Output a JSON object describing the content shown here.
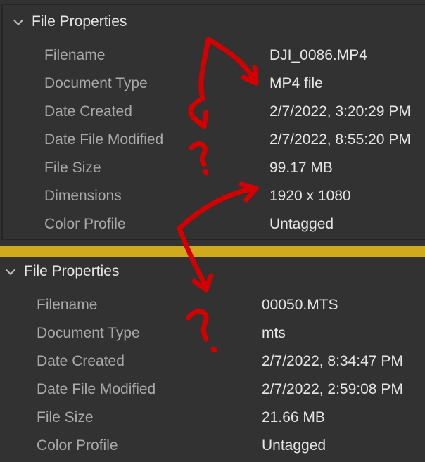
{
  "panels": [
    {
      "title": "File Properties",
      "rows": [
        {
          "label": "Filename",
          "value": "DJI_0086.MP4"
        },
        {
          "label": "Document Type",
          "value": "MP4 file"
        },
        {
          "label": "Date Created",
          "value": "2/7/2022, 3:20:29 PM"
        },
        {
          "label": "Date File Modified",
          "value": "2/7/2022, 8:55:20 PM"
        },
        {
          "label": "File Size",
          "value": "99.17 MB"
        },
        {
          "label": "Dimensions",
          "value": "1920 x 1080"
        },
        {
          "label": "Color Profile",
          "value": "Untagged"
        }
      ]
    },
    {
      "title": "File Properties",
      "rows": [
        {
          "label": "Filename",
          "value": "00050.MTS"
        },
        {
          "label": "Document Type",
          "value": "mts"
        },
        {
          "label": "Date Created",
          "value": "2/7/2022, 8:34:47 PM"
        },
        {
          "label": "Date File Modified",
          "value": "2/7/2022, 2:59:08 PM"
        },
        {
          "label": "File Size",
          "value": "21.66 MB"
        },
        {
          "label": "Color Profile",
          "value": "Untagged"
        }
      ]
    }
  ],
  "annotation_color": "#d40000"
}
